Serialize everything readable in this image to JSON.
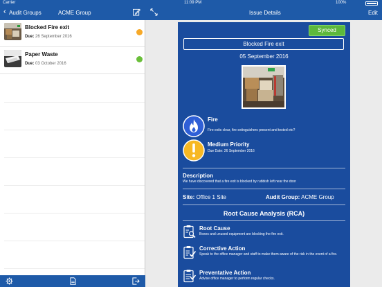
{
  "status_bar": {
    "carrier": "Carrier",
    "time": "11:09 PM",
    "battery": "100%"
  },
  "left_nav": {
    "back_label": "Audit Groups",
    "title": "ACME Group"
  },
  "right_nav": {
    "title": "Issue Details",
    "edit_label": "Edit"
  },
  "issues": [
    {
      "name": "Blocked Fire exit",
      "due_label": "Due:",
      "due_date": "26 September 2016",
      "status_color": "#f7a928"
    },
    {
      "name": "Paper Waste",
      "due_label": "Due:",
      "due_date": "03 October 2016",
      "status_color": "#6abf3a"
    }
  ],
  "detail": {
    "sync_status": "Synced",
    "title": "Blocked Fire exit",
    "date": "05 September 2016",
    "category": {
      "name": "Fire",
      "description": "Fire exits clear, fire extinguishers present and tested etc?"
    },
    "priority": {
      "name": "Medium Priority",
      "due": "Due Date: 26 September 2016"
    },
    "description": {
      "heading": "Description",
      "text": "We have discovered that a fire exit is blocked by rubbish left near the door"
    },
    "site": {
      "label": "Site:",
      "value": "Office 1 Site"
    },
    "audit_group": {
      "label": "Audit Group:",
      "value": "ACME Group"
    },
    "rca": {
      "heading": "Root Cause Analysis (RCA)",
      "items": [
        {
          "title": "Root Cause",
          "text": "Boxes and unused equipment are blocking the fire exit."
        },
        {
          "title": "Corrective Action",
          "text": "Speak to the office manager and staff to make them aware of the risk in the event of a fire."
        },
        {
          "title": "Preventative Action",
          "text": "Advise office manager to perform regular checks."
        }
      ]
    }
  },
  "colors": {
    "brand": "#1e5aa8",
    "card": "#1a4c9e",
    "synced": "#5cb83c",
    "fire_icon": "#2f5fd6",
    "priority_icon": "#f7b824"
  },
  "icons": [
    "chevron-left-icon",
    "compose-icon",
    "expand-icon",
    "settings-icon",
    "document-icon",
    "logout-icon",
    "fire-icon",
    "warning-icon",
    "clipboard-search-icon",
    "clipboard-check-icon",
    "clipboard-list-icon"
  ]
}
